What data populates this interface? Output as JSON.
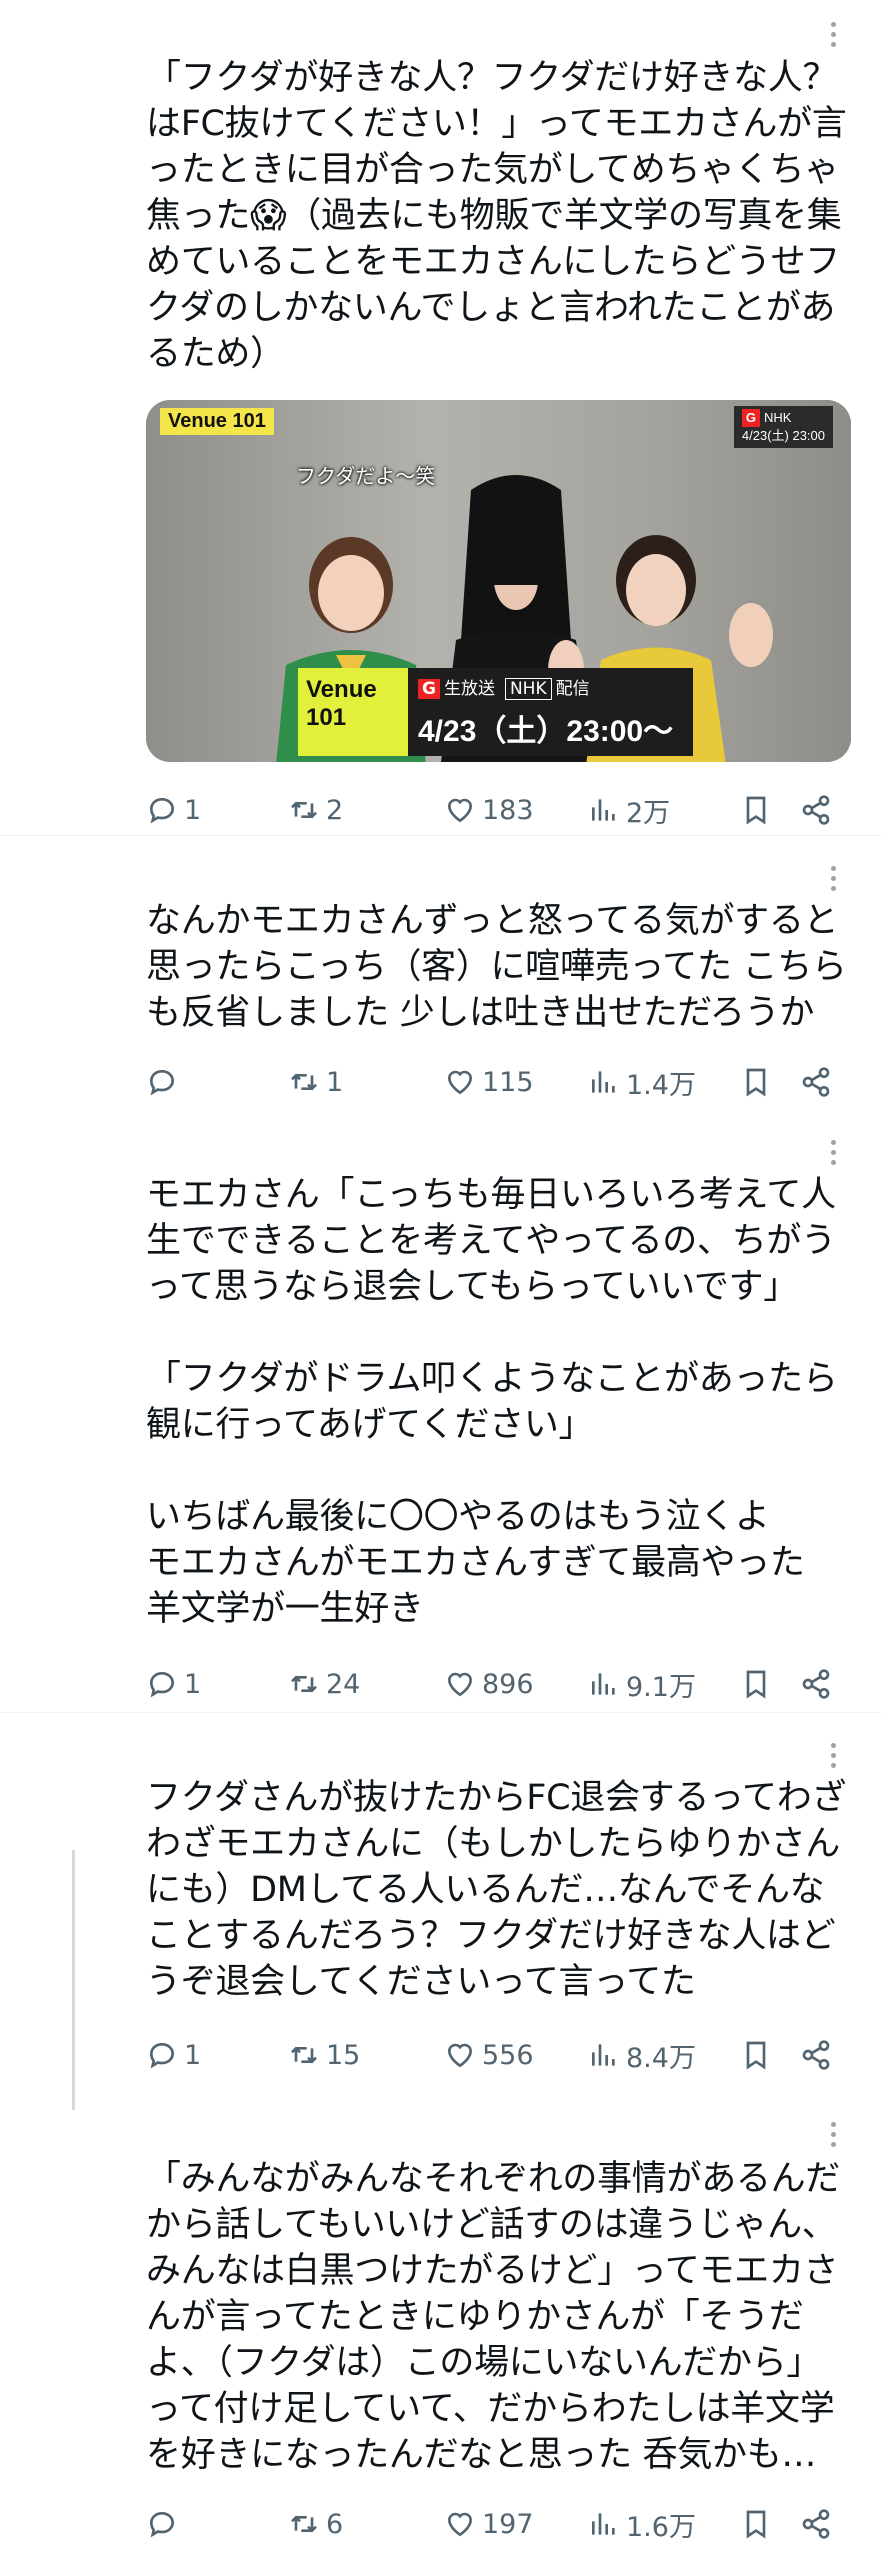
{
  "tweets": [
    {
      "text": "「フクダが好きな人？フクダだけ好きな人？はFC抜けてください！」ってモエカさんが言ったときに目が合った気がしてめちゃくちゃ焦った😱（過去にも物販で羊文学の写真を集めていることをモエカさんにしたらどうせフクダのしかないんでしょと言われたことがあるため）",
      "media": {
        "venue_tag": "Venue 101",
        "channel_badge": "G",
        "network": "NHK",
        "corner_datetime": "4/23(土) 23:00",
        "caption": "フクダだよ〜笑",
        "lower_venue": "Venue 101",
        "live_label": "生放送",
        "stream_label": "配信",
        "lower_datetime": "4/23（土）23:00〜"
      },
      "replies": "1",
      "retweets": "2",
      "likes": "183",
      "views": "2万"
    },
    {
      "text": "なんかモエカさんずっと怒ってる気がすると思ったらこっち（客）に喧嘩売ってた こちらも反省しました 少しは吐き出せただろうか",
      "replies": "",
      "retweets": "1",
      "likes": "115",
      "views": "1.4万"
    },
    {
      "text": "モエカさん「こっちも毎日いろいろ考えて人生でできることを考えてやってるの、ちがうって思うなら退会してもらっていいです」\n\n「フクダがドラム叩くようなことがあったら観に行ってあげてください」\n\nいちばん最後に〇〇やるのはもう泣くよ\nモエカさんがモエカさんすぎて最高やった\n羊文学が一生好き",
      "replies": "1",
      "retweets": "24",
      "likes": "896",
      "views": "9.1万"
    },
    {
      "text": "フクダさんが抜けたからFC退会するってわざわざモエカさんに（もしかしたらゆりかさんにも）DMしてる人いるんだ…なんでそんなことするんだろう？フクダだけ好きな人はどうぞ退会してくださいって言ってた",
      "replies": "1",
      "retweets": "15",
      "likes": "556",
      "views": "8.4万"
    },
    {
      "text": "「みんながみんなそれぞれの事情があるんだから話してもいいけど話すのは違うじゃん、みんなは白黒つけたがるけど」ってモエカさんが言ってたときにゆりかさんが「そうだよ、（フクダは）この場にいないんだから」って付け足していて、だからわたしは羊文学を好きになったんだなと思った 呑気かも…",
      "replies": "",
      "retweets": "6",
      "likes": "197",
      "views": "1.6万"
    }
  ],
  "colors": {
    "text": "#0f1419",
    "muted": "#536471",
    "divider": "#eff3f4",
    "accent": "#1d9bf0"
  },
  "icons": [
    "reply-icon",
    "retweet-icon",
    "like-icon",
    "views-icon",
    "bookmark-icon",
    "share-icon",
    "more-icon"
  ]
}
